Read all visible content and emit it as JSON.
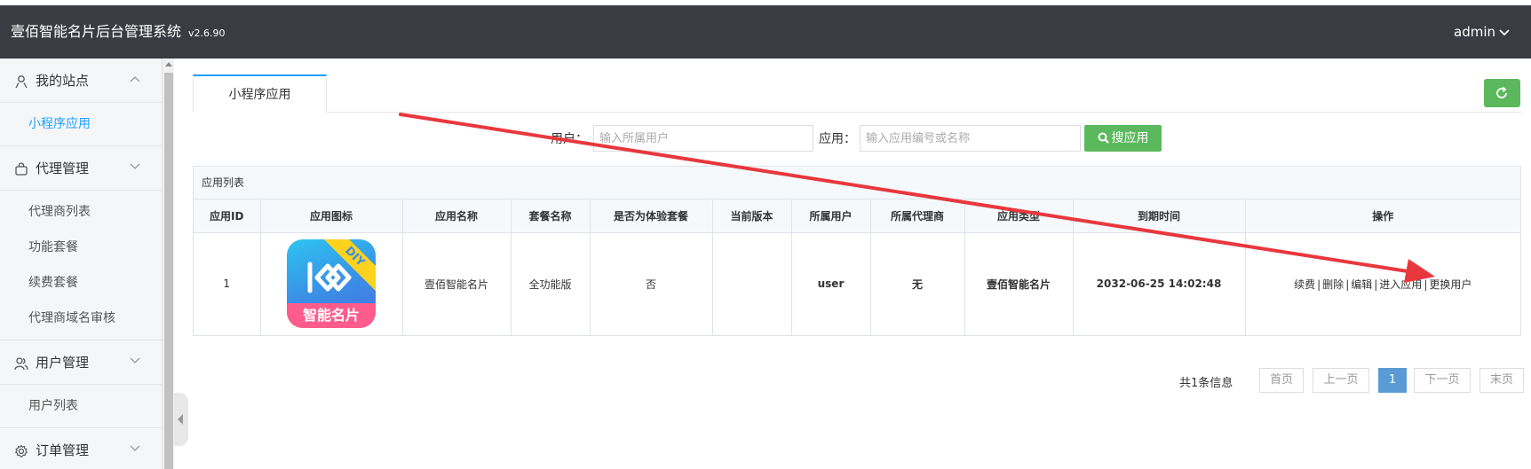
{
  "header": {
    "title": "壹佰智能名片后台管理系统",
    "version": "v2.6.90",
    "user": "admin"
  },
  "sidebar": {
    "groups": [
      {
        "label": "我的站点",
        "icon": "user-icon",
        "expanded": true,
        "items": [
          "小程序应用"
        ]
      },
      {
        "label": "代理管理",
        "icon": "bag-icon",
        "expanded": true,
        "items": [
          "代理商列表",
          "功能套餐",
          "续费套餐",
          "代理商域名审核"
        ]
      },
      {
        "label": "用户管理",
        "icon": "users-icon",
        "expanded": true,
        "items": [
          "用户列表"
        ]
      },
      {
        "label": "订单管理",
        "icon": "gear-icon",
        "expanded": false,
        "items": []
      }
    ],
    "active_item": "小程序应用"
  },
  "tabs": [
    {
      "label": "小程序应用",
      "active": true
    }
  ],
  "search": {
    "user_label": "用户：",
    "user_placeholder": "输入所属用户",
    "app_label": "应用：",
    "app_placeholder": "输入应用编号或名称",
    "button": "搜应用"
  },
  "panel": {
    "title": "应用列表",
    "columns": [
      "应用ID",
      "应用图标",
      "应用名称",
      "套餐名称",
      "是否为体验套餐",
      "当前版本",
      "所属用户",
      "所属代理商",
      "应用类型",
      "到期时间",
      "操作"
    ],
    "rows": [
      {
        "id": "1",
        "icon_text": "智能名片",
        "icon_badge": "DIY",
        "name": "壹佰智能名片",
        "package": "全功能版",
        "trial": "否",
        "version": "",
        "user": "user",
        "agent": "无",
        "type": "壹佰智能名片",
        "expire": "2032-06-25 14:02:48",
        "actions": [
          "续费",
          "删除",
          "编辑",
          "进入应用",
          "更换用户"
        ]
      }
    ]
  },
  "pagination": {
    "info": "共1条信息",
    "first": "首页",
    "prev": "上一页",
    "current": "1",
    "next": "下一页",
    "last": "末页"
  },
  "colors": {
    "header_bg": "#393d42",
    "accent": "#1e9fff",
    "green": "#5cb85c",
    "annotation_arrow": "#e8383d"
  }
}
